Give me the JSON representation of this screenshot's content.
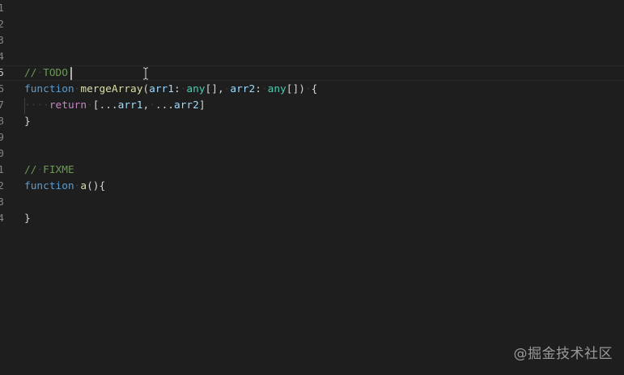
{
  "editor": {
    "line_numbers": [
      "1",
      "2",
      "3",
      "4",
      "5",
      "6",
      "7",
      "8",
      "9",
      "0",
      "1",
      "2",
      "3",
      "4"
    ],
    "active_line_index": 4
  },
  "code": {
    "line5": {
      "comment": "//",
      "space": "·",
      "text": "TODO"
    },
    "line6": {
      "keyword": "function",
      "space": "·",
      "name": "mergeArray",
      "open": "(",
      "param1": "arr1",
      "colon1": ":",
      "space1": "·",
      "type1": "any",
      "brackets1": "[]",
      "comma": ",",
      "space2": "·",
      "param2": "arr2",
      "colon2": ":",
      "space3": "·",
      "type2": "any",
      "brackets2": "[]",
      "close": ")",
      "space4": "·",
      "brace": "{"
    },
    "line7": {
      "indent": "····",
      "keyword": "return",
      "space": "·",
      "open": "[",
      "spread1": "...",
      "arr1": "arr1",
      "comma": ",",
      "space2": "·",
      "spread2": "...",
      "arr2": "arr2",
      "close": "]"
    },
    "line8": {
      "brace": "}"
    },
    "line11": {
      "comment": "//",
      "space": "·",
      "text": "FIXME"
    },
    "line12": {
      "keyword": "function",
      "space": "·",
      "name": "a",
      "parens": "()",
      "brace": "{"
    },
    "line14": {
      "brace": "}"
    }
  },
  "watermark": "@掘金技术社区"
}
